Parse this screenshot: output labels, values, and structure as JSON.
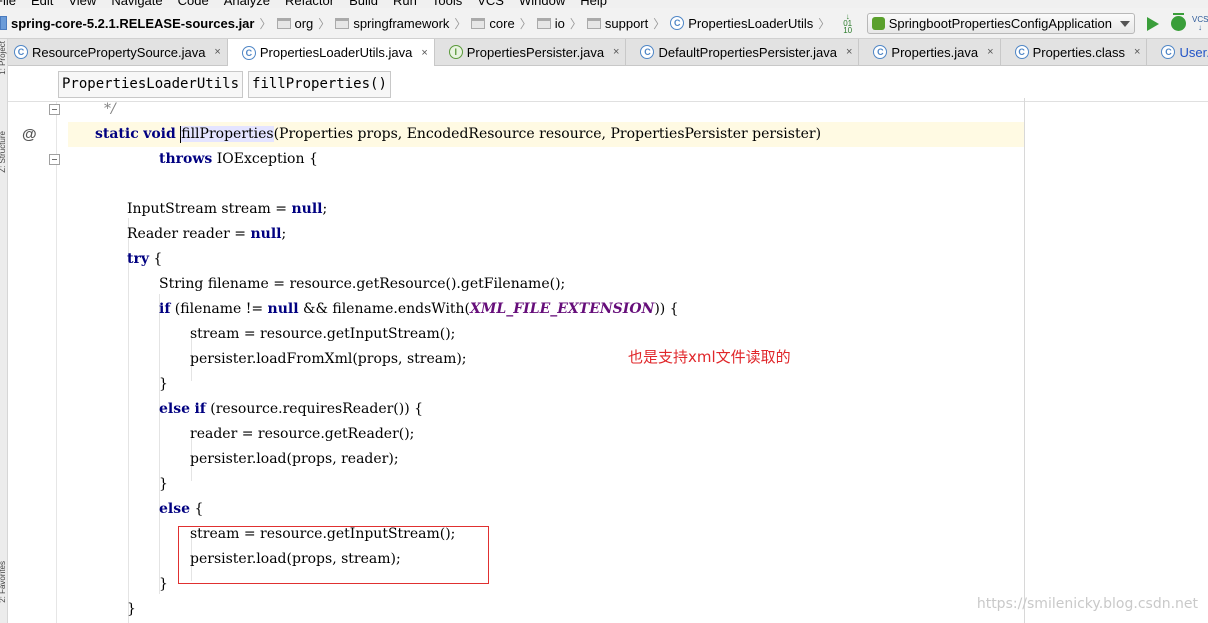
{
  "menu": [
    "File",
    "Edit",
    "View",
    "Navigate",
    "Code",
    "Analyze",
    "Refactor",
    "Build",
    "Run",
    "Tools",
    "VCS",
    "Window",
    "Help"
  ],
  "breadcrumb": {
    "jar": "spring-core-5.2.1.RELEASE-sources.jar",
    "folders": [
      "org",
      "springframework",
      "core",
      "io",
      "support"
    ],
    "class": "PropertiesLoaderUtils"
  },
  "run_config": {
    "name": "SpringbootPropertiesConfigApplication",
    "vcs_label": "VCS"
  },
  "tabs": [
    {
      "label": "ResourcePropertySource.java",
      "icon": "class-icon",
      "close": "×",
      "active": false
    },
    {
      "label": "PropertiesLoaderUtils.java",
      "icon": "class-icon",
      "close": "×",
      "active": true
    },
    {
      "label": "PropertiesPersister.java",
      "icon": "interface-icon",
      "close": "×",
      "active": false
    },
    {
      "label": "DefaultPropertiesPersister.java",
      "icon": "class-icon",
      "close": "×",
      "active": false
    },
    {
      "label": "Properties.java",
      "icon": "class-icon",
      "close": "×",
      "active": false
    },
    {
      "label": "Properties.class",
      "icon": "class-icon",
      "close": "×",
      "active": false
    },
    {
      "label": "User.java",
      "icon": "class-icon",
      "close": "×",
      "active": false
    }
  ],
  "left_strip": [
    "1: Project",
    "Z: Structure",
    "2: Favorites"
  ],
  "structure": [
    "PropertiesLoaderUtils",
    "fillProperties()"
  ],
  "gutter": {
    "override_marker": "@"
  },
  "code": {
    "l01": "*/",
    "l02": {
      "kw1": "static",
      "kw2": "void",
      "name": "fillProperties",
      "params": "(Properties props, EncodedResource resource, PropertiesPersister persister)"
    },
    "l03": {
      "kw": "throws",
      "rest": " IOException {"
    },
    "l05": {
      "pre": "InputStream stream = ",
      "kw": "null",
      "post": ";"
    },
    "l06": {
      "pre": "Reader reader = ",
      "kw": "null",
      "post": ";"
    },
    "l07": {
      "kw": "try",
      "post": " {"
    },
    "l08": "String filename = resource.getResource().getFilename();",
    "l09": {
      "kw1": "if",
      "mid": " (filename != ",
      "kw2": "null",
      "mid2": " && filename.endsWith(",
      "const": "XML_FILE_EXTENSION",
      "post": ")) {"
    },
    "l10": "stream = resource.getInputStream();",
    "l11": "persister.loadFromXml(props, stream);",
    "l12": "}",
    "l13": {
      "kw1": "else",
      "kw2": "if",
      "post": " (resource.requiresReader()) {"
    },
    "l14": "reader = resource.getReader();",
    "l15": "persister.load(props, reader);",
    "l16": "}",
    "l17": {
      "kw": "else",
      "post": " {"
    },
    "l18": "stream = resource.getInputStream();",
    "l19": "persister.load(props, stream);",
    "l20": "}",
    "l21": "}"
  },
  "annotation": "也是支持xml文件读取的",
  "watermark": "https://smilenicky.blog.csdn.net"
}
